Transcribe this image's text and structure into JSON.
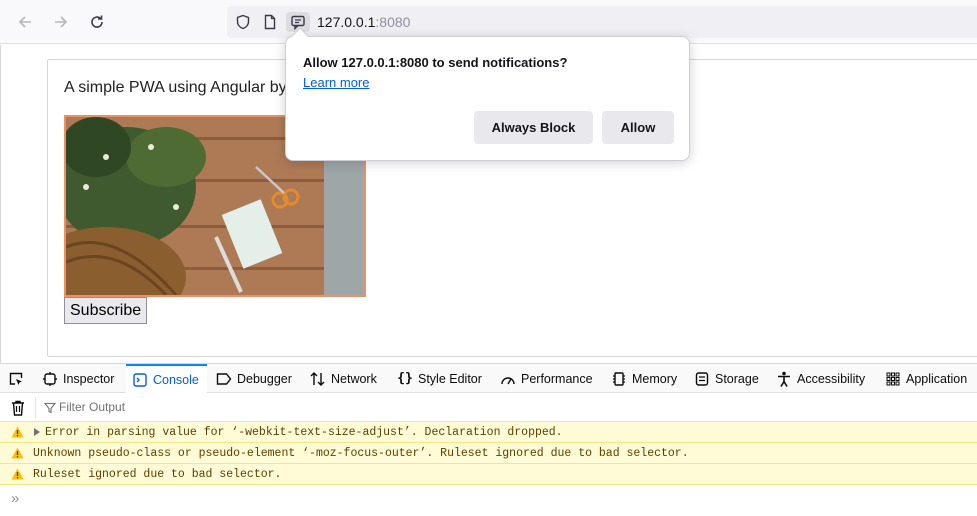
{
  "browser": {
    "url_host": "127.0.0.1",
    "url_port": ":8080"
  },
  "page": {
    "headline": "A simple PWA using Angular by",
    "subscribe_label": "Subscribe"
  },
  "notification_popup": {
    "message": "Allow 127.0.0.1:8080 to send notifications?",
    "learn_more": "Learn more",
    "block_label": "Always Block",
    "allow_label": "Allow"
  },
  "devtools": {
    "tabs": [
      {
        "label": "Inspector",
        "icon": "inspector-icon"
      },
      {
        "label": "Console",
        "icon": "console-icon",
        "selected": true
      },
      {
        "label": "Debugger",
        "icon": "debugger-icon"
      },
      {
        "label": "Network",
        "icon": "network-icon"
      },
      {
        "label": "Style Editor",
        "icon": "style-editor-icon"
      },
      {
        "label": "Performance",
        "icon": "performance-icon"
      },
      {
        "label": "Memory",
        "icon": "memory-icon"
      },
      {
        "label": "Storage",
        "icon": "storage-icon"
      },
      {
        "label": "Accessibility",
        "icon": "accessibility-icon"
      },
      {
        "label": "Application",
        "icon": "application-icon"
      }
    ],
    "filter_placeholder": "Filter Output",
    "messages": [
      "Error in parsing value for ‘-webkit-text-size-adjust’.  Declaration dropped.",
      "Unknown pseudo-class or pseudo-element ‘-moz-focus-outer’.  Ruleset ignored due to bad selector.",
      "Ruleset ignored due to bad selector."
    ],
    "prompt": "»"
  },
  "colors": {
    "accent_blue": "#0060df",
    "warning_bg": "#fffbd6",
    "warning_text": "#5e4000",
    "image_border": "#e8926a"
  }
}
